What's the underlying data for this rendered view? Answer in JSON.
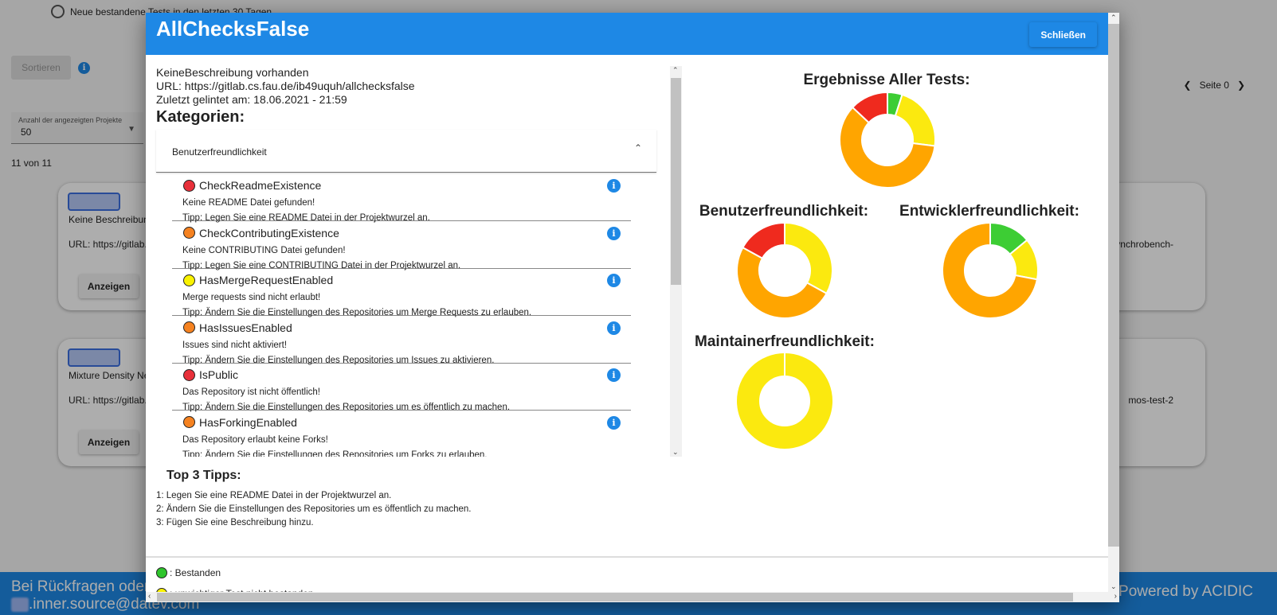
{
  "background": {
    "radio_label": "Neue bestandene Tests in den letzten 30 Tagen",
    "sort_button": "Sortieren",
    "select_label": "Anzahl der angezeigten Projekte",
    "select_value": "50",
    "count_text": "11 von 11",
    "page_label": "Seite 0",
    "card1": {
      "desc": "Keine Beschreibung vorhanden",
      "url": "URL: https://gitlab.cs.fau.de",
      "right": "ynchrobench-",
      "button": "Anzeigen"
    },
    "card2": {
      "desc": "Mixture Density Networks",
      "url": "URL: https://gitlab.cs.fau.de",
      "right": "mos-test-2",
      "button": "Anzeigen"
    },
    "footer_left_1": "Bei Rückfragen oder",
    "footer_left_2": ".inner.source@datev.com",
    "footer_right": "Powered by ACIDIC"
  },
  "dialog": {
    "title": "AllChecksFalse",
    "close_label": "Schließen",
    "description": "KeineBeschreibung vorhanden",
    "url": "URL: https://gitlab.cs.fau.de/ib49uquh/allchecksfalse",
    "linted": "Zuletzt gelintet am: 18.06.2021 - 21:59",
    "categories_heading": "Kategorien:",
    "panel_title": "Benutzerfreundlichkeit",
    "tests": [
      {
        "name": "CheckReadmeExistence",
        "status": "red",
        "message": "Keine README Datei gefunden!",
        "tip": "Tipp: Legen Sie eine README Datei in der Projektwurzel an."
      },
      {
        "name": "CheckContributingExistence",
        "status": "orange",
        "message": "Keine CONTRIBUTING Datei gefunden!",
        "tip": "Tipp: Legen Sie eine CONTRIBUTING Datei in der Projektwurzel an."
      },
      {
        "name": "HasMergeRequestEnabled",
        "status": "yellow",
        "message": "Merge requests sind nicht erlaubt!",
        "tip": "Tipp: Ändern Sie die Einstellungen des Repositories um Merge Requests zu erlauben."
      },
      {
        "name": "HasIssuesEnabled",
        "status": "orange",
        "message": "Issues sind nicht aktiviert!",
        "tip": "Tipp: Ändern Sie die Einstellungen des Repositories um Issues zu aktivieren."
      },
      {
        "name": "IsPublic",
        "status": "red",
        "message": "Das Repository ist nicht öffentlich!",
        "tip": "Tipp: Ändern Sie die Einstellungen des Repositories um es öffentlich zu machen."
      },
      {
        "name": "HasForkingEnabled",
        "status": "orange",
        "message": "Das Repository erlaubt keine Forks!",
        "tip": "Tipp: Ändern Sie die Einstellungen des Repositories um Forks zu erlauben."
      }
    ],
    "top3_heading": "Top 3 Tipps:",
    "top3": [
      "1: Legen Sie eine README Datei in der Projektwurzel an.",
      "2: Ändern Sie die Einstellungen des Repositories um es öffentlich zu machen.",
      "3: Fügen Sie eine Beschreibung hinzu."
    ],
    "legend": [
      {
        "color": "green",
        "label": ": Bestanden"
      },
      {
        "color": "yellow",
        "label": ": unwichtiger Test nicht bestanden"
      }
    ]
  },
  "colors": {
    "red": "#ef2a1e",
    "orange": "#ffa500",
    "yellow": "#fbe90f",
    "green": "#3dcd34",
    "accent": "#1e88e5",
    "dot_red": "#e8303a",
    "dot_orange": "#f58220",
    "dot_yellow": "#f9f200",
    "dot_green": "#2fc52c"
  },
  "chart_data": [
    {
      "type": "pie",
      "title": "Ergebnisse Aller Tests:",
      "categories": [
        "green",
        "yellow",
        "orange",
        "red"
      ],
      "values": [
        5,
        22,
        60,
        13
      ]
    },
    {
      "type": "pie",
      "title": "Benutzerfreundlichkeit:",
      "categories": [
        "yellow",
        "orange",
        "red"
      ],
      "values": [
        33,
        50,
        17
      ]
    },
    {
      "type": "pie",
      "title": "Entwicklerfreundlichkeit:",
      "categories": [
        "green",
        "yellow",
        "orange"
      ],
      "values": [
        14,
        14,
        72
      ]
    },
    {
      "type": "pie",
      "title": "Maintainerfreundlichkeit:",
      "categories": [
        "yellow"
      ],
      "values": [
        100
      ]
    }
  ]
}
